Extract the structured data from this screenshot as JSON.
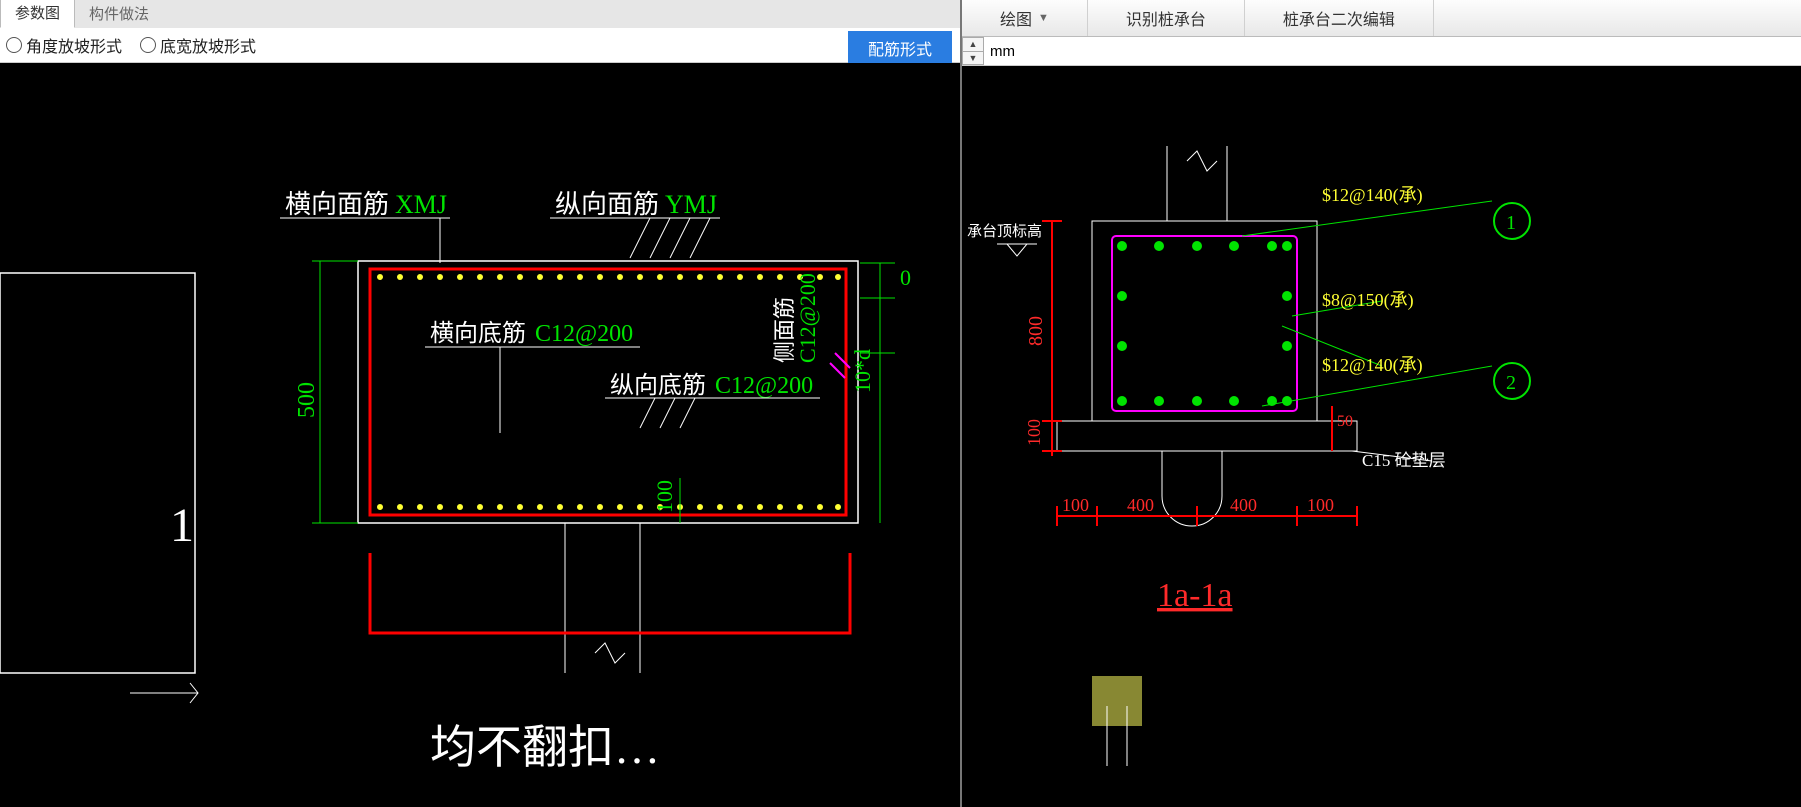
{
  "tabs": {
    "param": "参数图",
    "method": "构件做法"
  },
  "options": {
    "angle": "角度放坡形式",
    "width": "底宽放坡形式"
  },
  "button_rebar": "配筋形式",
  "right_btns": {
    "draw": "绘图",
    "detect": "识别桩承台",
    "edit": "桩承台二次编辑"
  },
  "unit": "mm",
  "left_labels": {
    "xmj_t": "横向面筋",
    "xmj_v": "XMJ",
    "ymj_t": "纵向面筋",
    "ymj_v": "YMJ",
    "hxd_t": "横向底筋",
    "hxd_v": "C12@200",
    "zxd_t": "纵向底筋",
    "zxd_v": "C12@200",
    "cmj_t": "侧面筋",
    "cmj_v": "C12@200",
    "dim_500": "500",
    "dim_100": "100",
    "dim_0": "0",
    "dim_10d": "10*d",
    "sect_1": "1",
    "bottom_text": "均不翻扣…"
  },
  "right_labels": {
    "top_note": "承台顶标高",
    "s12a": "$12@140(承)",
    "s8": "$8@150(承)",
    "s12b": "$12@140(承)",
    "c15": "C15 砼垫层",
    "dim_800": "800",
    "dim_100a": "100",
    "dim_50": "50",
    "d100l": "100",
    "d400a": "400",
    "d400b": "400",
    "d100r": "100",
    "sec": "1a-1a",
    "ball1": "1",
    "ball2": "2"
  }
}
